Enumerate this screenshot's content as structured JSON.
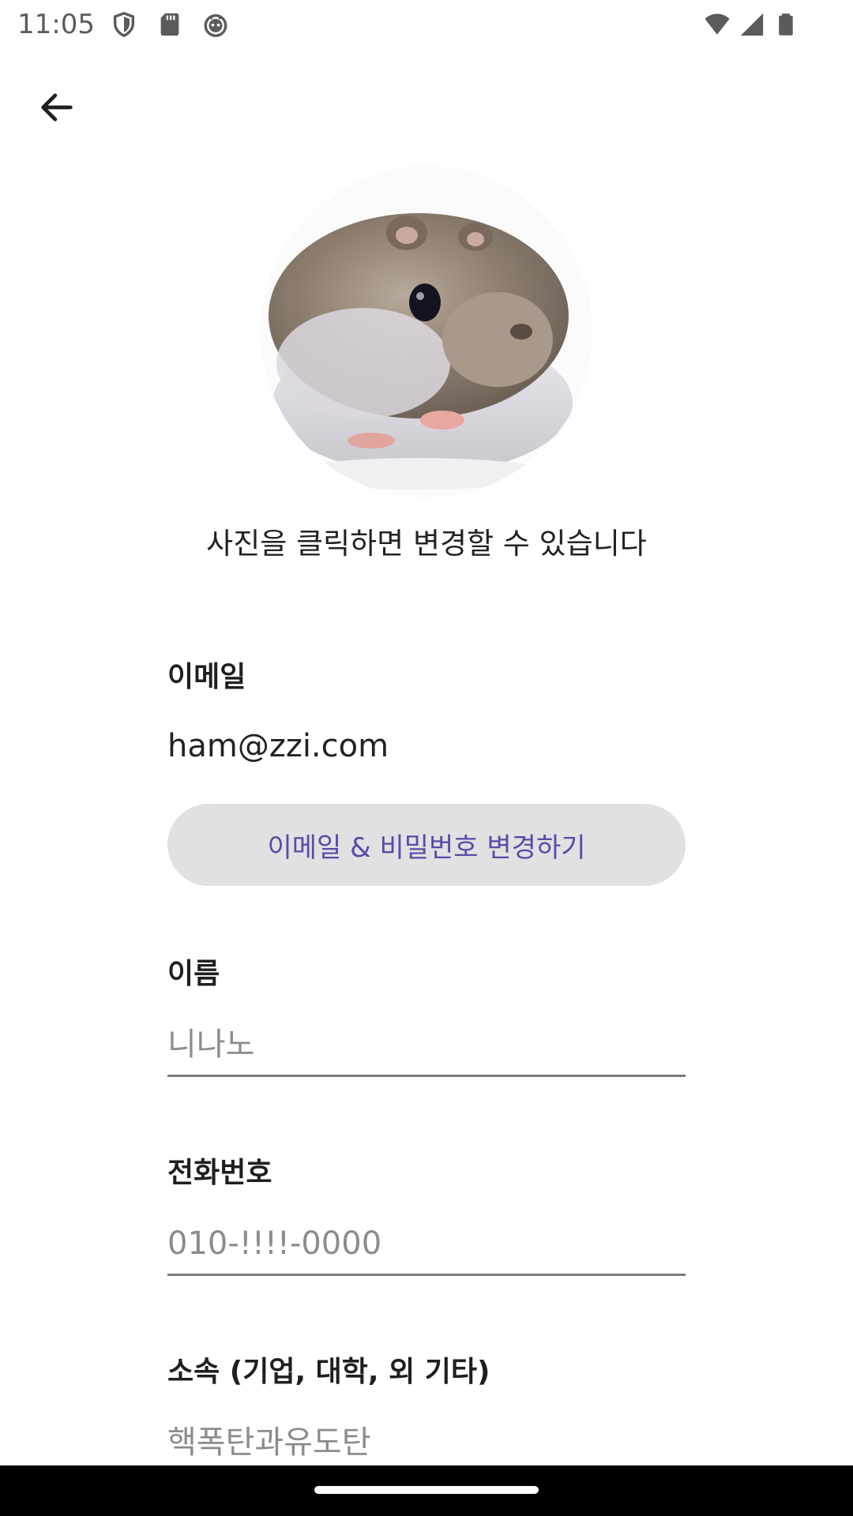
{
  "status_bar": {
    "time": "11:05",
    "left_icons": [
      "shield-icon",
      "sd-card-icon",
      "robot-icon"
    ],
    "right_icons": [
      "wifi-icon",
      "cell-signal-icon",
      "battery-icon"
    ]
  },
  "header": {
    "back_icon": "arrow-left-icon"
  },
  "profile": {
    "avatar_hint": "사진을 클릭하면 변경할 수 있습니다"
  },
  "form": {
    "email": {
      "label": "이메일",
      "value": "ham@zzi.com"
    },
    "change_button_label": "이메일 & 비밀번호 변경하기",
    "name": {
      "label": "이름",
      "placeholder": "니나노",
      "value": ""
    },
    "phone": {
      "label": "전화번호",
      "placeholder": "010-!!!!-0000",
      "value": ""
    },
    "affiliation": {
      "label": "소속 (기업, 대학, 외 기타)",
      "placeholder": "핵폭탄과유도탄",
      "value": ""
    }
  },
  "colors": {
    "accent_text": "#5c49a8",
    "button_bg": "#e1e1e1",
    "underline": "#7a7a7a"
  }
}
